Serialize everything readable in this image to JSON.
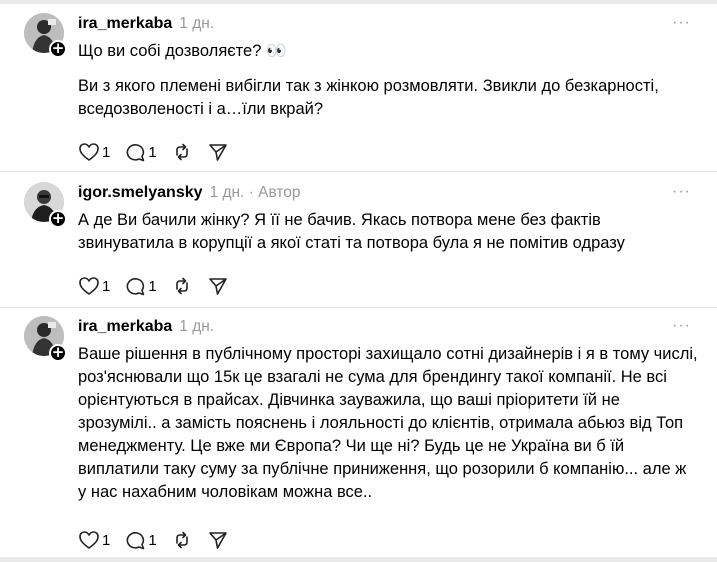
{
  "posts": [
    {
      "username": "ira_merkaba",
      "meta": "1 дн.",
      "more_label": "···",
      "paragraphs": [
        "Що ви собі дозволяєте? 👀",
        "Ви з якого племені вибігли так з жінкою розмовляти. Звикли до безкарності, вседозволеності і а…їли вкрай?"
      ],
      "likes": "1",
      "replies": "1",
      "icons": [
        "heart-icon",
        "comment-icon",
        "repost-icon",
        "share-icon"
      ]
    },
    {
      "username": "igor.smelyansky",
      "meta": "1 дн. · Автор",
      "more_label": "···",
      "paragraphs": [
        "А де Ви бачили жінку? Я її не бачив. Якась потвора мене без фактів звинуватила в корупції а якої статі та потвора була я не помітив одразу"
      ],
      "likes": "1",
      "replies": "1",
      "icons": [
        "heart-icon",
        "comment-icon",
        "repost-icon",
        "share-icon"
      ]
    },
    {
      "username": "ira_merkaba",
      "meta": "1 дн.",
      "more_label": "···",
      "paragraphs": [
        "Ваше рішення в публічному просторі захищало сотні дизайнерів і я в тому числі, роз'яснювали що 15к це взагалі не сума для брендингу такої компанії. Не всі орієнтуються в прайсах. Дівчинка зауважила, що ваші пріоритети їй не зрозумілі.. а замість пояснень і лояльності до клієнтів, отримала абьюз від Топ менеджменту. Це вже ми Європа? Чи ще ні? Будь це не Україна ви б їй виплатили таку суму за публічне приниження, що розорили б компанію... але ж у нас нахабним чоловікам можна все.."
      ],
      "likes": "1",
      "replies": "1",
      "icons": [
        "heart-icon",
        "comment-icon",
        "repost-icon",
        "share-icon"
      ]
    }
  ]
}
